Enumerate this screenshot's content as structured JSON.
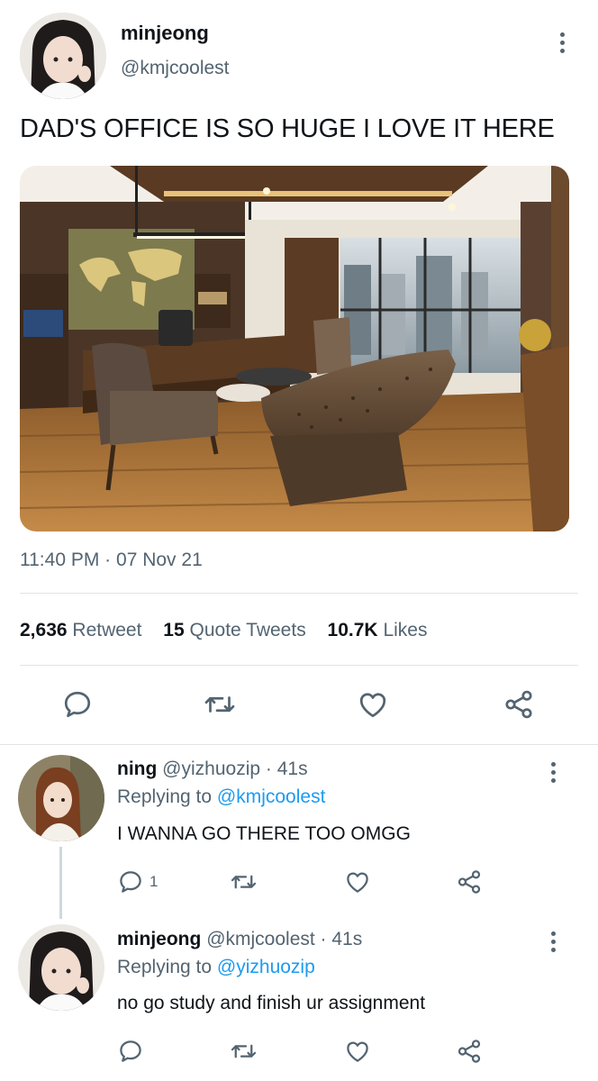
{
  "tweet": {
    "author_name": "minjeong",
    "author_handle": "@kmjcoolest",
    "text": "DAD'S OFFICE IS SO HUGE I LOVE IT HERE",
    "time": "11:40 PM",
    "dot": "·",
    "date": "07 Nov 21",
    "stats": {
      "retweets_count": "2,636",
      "retweets_label": "Retweet",
      "quotes_count": "15",
      "quotes_label": "Quote Tweets",
      "likes_count": "10.7K",
      "likes_label": "Likes"
    }
  },
  "replies": [
    {
      "name": "ning",
      "handle": "@yizhuozip",
      "time": "· 41s",
      "replying_prefix": "Replying to",
      "replying_to": "@kmjcoolest",
      "text": "I WANNA GO THERE TOO OMGG",
      "reply_count": "1"
    },
    {
      "name": "minjeong",
      "handle": "@kmjcoolest",
      "time": "· 41s",
      "replying_prefix": "Replying to",
      "replying_to": "@yizhuozip",
      "text": "no go study and finish ur assignment",
      "reply_count": ""
    }
  ],
  "icons": [
    "more-vertical-icon",
    "reply-icon",
    "retweet-icon",
    "like-icon",
    "share-icon"
  ],
  "colors": {
    "accent": "#1d9bf0",
    "text": "#0f1419",
    "muted": "#536471",
    "divider": "#e1e4e8"
  }
}
